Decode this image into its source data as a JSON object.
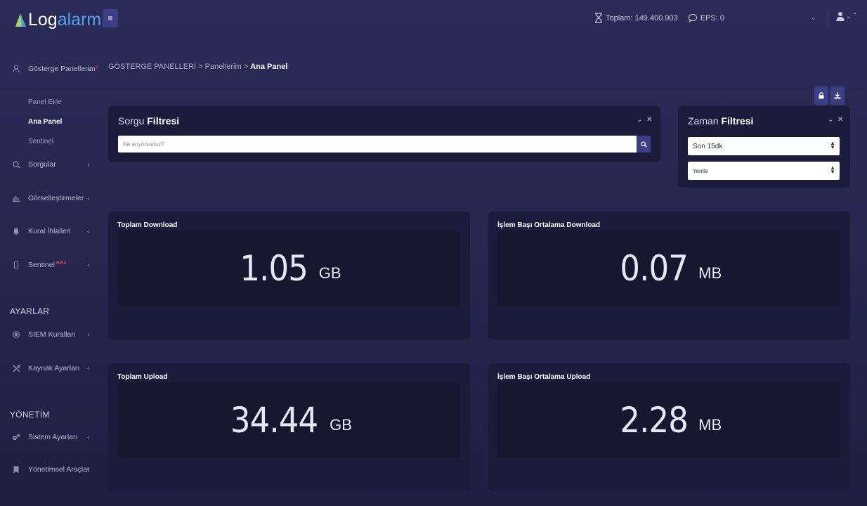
{
  "app": {
    "logo_part1": "Log",
    "logo_part2": "alarm",
    "menu_toggle": "≡"
  },
  "header": {
    "total": "Toplam: 149.400.903",
    "eps": "EPS: 0",
    "chevron": "⌄",
    "user_chevron": "⌄ ˇ"
  },
  "sidebar": {
    "dashboards": {
      "label": "Gösterge Panellerim",
      "badge": "2"
    },
    "sub_items": [
      "Panel Ekle",
      "Ana Panel",
      "Sentinel"
    ],
    "items": [
      {
        "label": "Sorgular"
      },
      {
        "label": "Görselleştirmeler"
      },
      {
        "label": "Kural İhlalleri"
      },
      {
        "label": "Sentinel",
        "badge": "Beta"
      }
    ],
    "settings_heading": "AYARLAR",
    "settings_items": [
      {
        "label": "SIEM Kuralları"
      },
      {
        "label": "Kaynak Ayarları"
      }
    ],
    "management_heading": "YÖNETİM",
    "management_items": [
      {
        "label": "Sistem Ayarları"
      },
      {
        "label": "Yönetimsel Araçlar"
      }
    ],
    "chevron": "‹"
  },
  "breadcrumb": {
    "part1": "GÖSTERGE PANELLERİ",
    "part2": "Panellerim",
    "current": "Ana Panel",
    "sep": ">"
  },
  "query_filter": {
    "title_light": "Sorgu ",
    "title_bold": "Filtresi",
    "placeholder": "Ne arıyorsunuz?",
    "collapse": "⌄",
    "close": "✕"
  },
  "time_filter": {
    "title_light": "Zaman ",
    "title_bold": "Filtresi",
    "range": "Son 15dk",
    "refresh": "Yenile",
    "collapse": "⌄",
    "close": "✕"
  },
  "metrics": [
    {
      "title": "Toplam Download",
      "value": "1.05",
      "unit": "GB"
    },
    {
      "title": "İşlem Başı Ortalama Download",
      "value": "0.07",
      "unit": "MB"
    },
    {
      "title": "Toplam Upload",
      "value": "34.44",
      "unit": "GB"
    },
    {
      "title": "İşlem Başı Ortalama Upload",
      "value": "2.28",
      "unit": "MB"
    }
  ],
  "colors": {
    "accent": "#3d3f84",
    "logo_blue": "#4fa3e8",
    "panel": "#1b1b3c",
    "badge": "#ff4a4a"
  }
}
